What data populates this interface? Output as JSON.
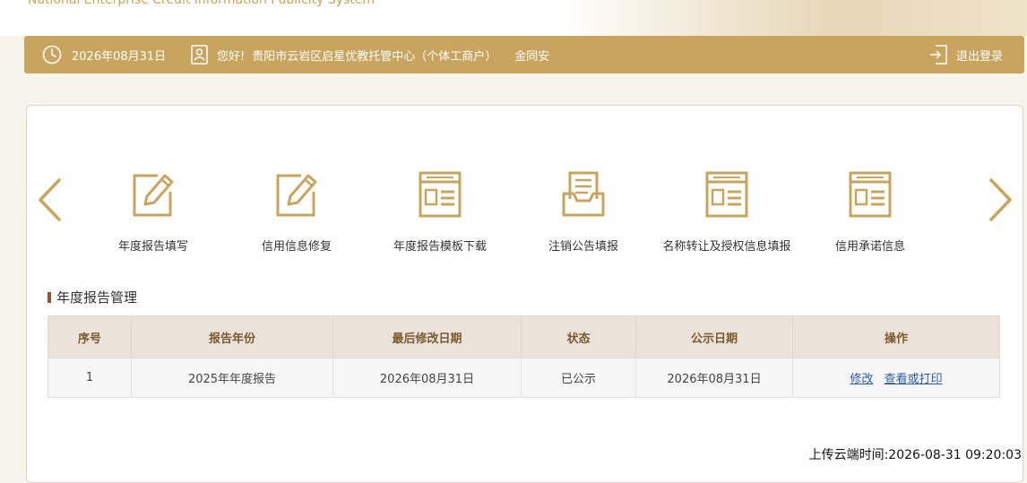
{
  "header": {
    "title_en": "National Enterprise Credit Information Publicity System"
  },
  "infobar": {
    "date": "2026年08月31日",
    "greeting": "您好!",
    "entity": "贵阳市云岩区启星优教托管中心（个体工商户）",
    "person": "金同安",
    "logout_label": "退出登录"
  },
  "features": [
    {
      "label": "年度报告填写",
      "icon": "edit-icon"
    },
    {
      "label": "信用信息修复",
      "icon": "edit-icon"
    },
    {
      "label": "年度报告模板下载",
      "icon": "document-icon"
    },
    {
      "label": "注销公告填报",
      "icon": "inbox-icon"
    },
    {
      "label": "名称转让及授权信息填报",
      "icon": "document-icon"
    },
    {
      "label": "信用承诺信息",
      "icon": "document-icon"
    }
  ],
  "section_title": "年度报告管理",
  "table": {
    "headers": [
      "序号",
      "报告年份",
      "最后修改日期",
      "状态",
      "公示日期",
      "操作"
    ],
    "rows": [
      {
        "index": "1",
        "year": "2025年年度报告",
        "modified": "2026年08月31日",
        "status": "已公示",
        "publish_date": "2026年08月31日",
        "action_edit": "修改",
        "action_view": "查看或打印"
      }
    ]
  },
  "footer": {
    "upload_time": "上传云端时间:2026-08-31 09:20:03"
  },
  "colors": {
    "accent": "#c8a45e",
    "icon": "#c8a45e",
    "link": "#2e5aa8"
  }
}
